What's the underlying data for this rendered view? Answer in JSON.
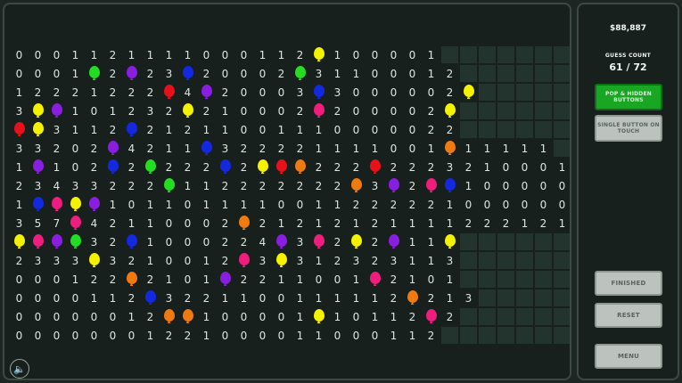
{
  "header": {
    "score": "$88,887",
    "guess_label": "Guess Count",
    "guess_value": "61 / 72"
  },
  "buttons": {
    "pop_hidden": "Pop & Hidden Buttons",
    "single_button": "Single Button On Touch",
    "finished": "Finished",
    "reset": "Reset",
    "menu": "Menu"
  },
  "sound_icon": "speaker-icon",
  "colors": {
    "red": "#e8101a",
    "green": "#22dd22",
    "blue": "#1428e0",
    "purple": "#8a1ee0",
    "yellow": "#f5f200",
    "pink": "#ee1d7e",
    "orange": "#f07a12"
  },
  "grid": [
    "000112111100011 2Y10000 1 ______",
    "0001G2P23B20002G31100012______",
    "12221222R4P20003B300000 2Y______",
    "3Y P101232Y21000 2K2 0000 2Y______",
    "RY3112B2121100111000 0 022______",
    "33202P421 1B3222211110 01O11111_",
    "1P102B2G222B2YRO222R2223 2100011",
    "2343322 2 G112222222O3P2KB1000000",
    "1BKYP101101111001122222 1000000",
    "357K421100 0 2O212121211 1 122 2121 1",
    "YKPG32B100022 4P3K2Y2P11Y______",
    "2333Y3210012K3Y312 323113______",
    "000122O2101P2211 0 01K2101______",
    "0000112B3221100111112O2 13______",
    "00000012OO100001Y101 1 2K2______",
    "0000000122100001 1 0 00112______"
  ]
}
